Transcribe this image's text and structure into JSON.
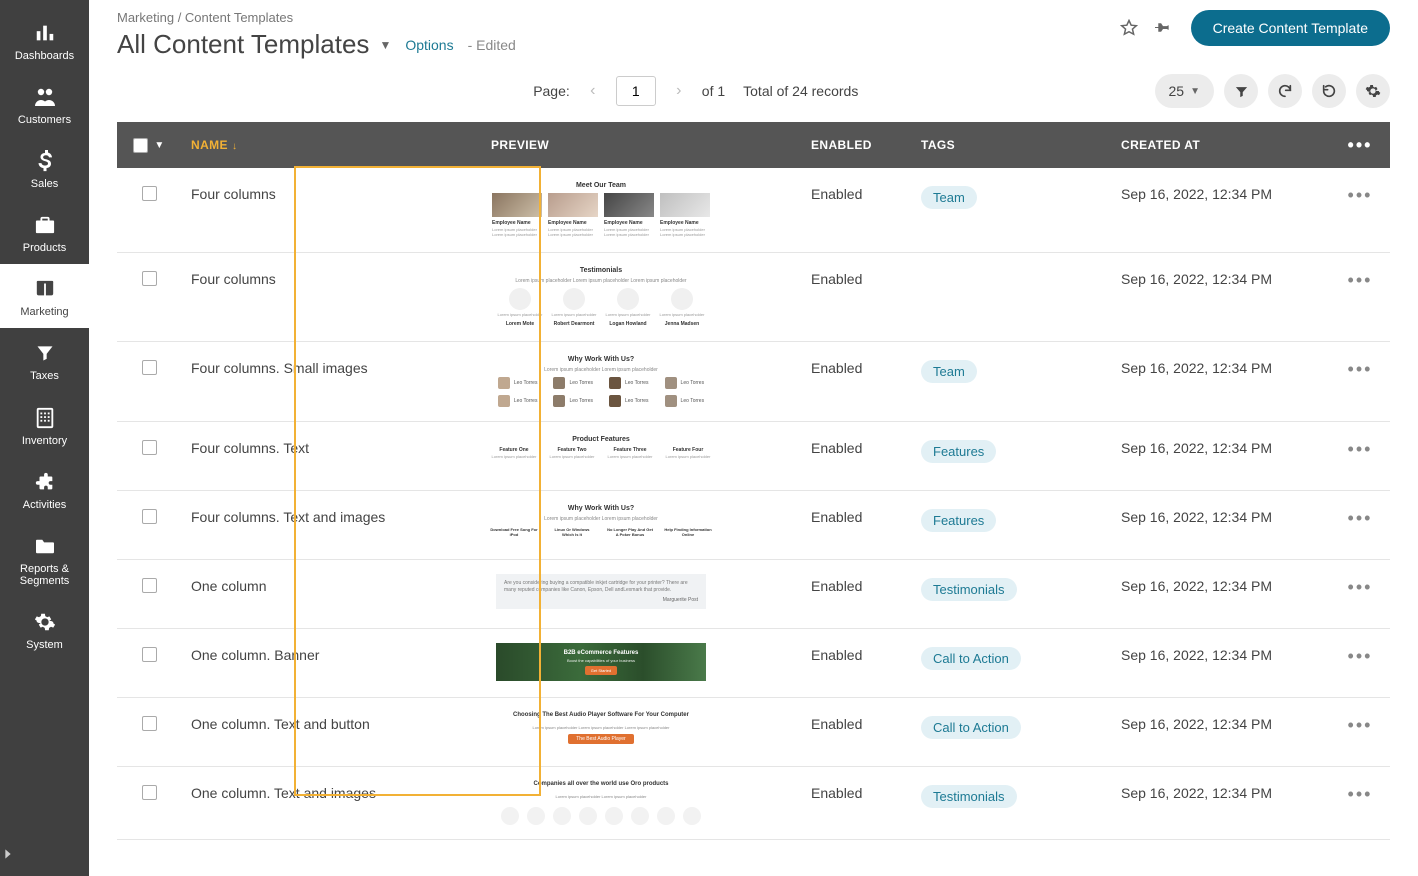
{
  "sidebar": {
    "items": [
      {
        "label": "Dashboards",
        "icon": "dashboards"
      },
      {
        "label": "Customers",
        "icon": "customers"
      },
      {
        "label": "Sales",
        "icon": "sales"
      },
      {
        "label": "Products",
        "icon": "products"
      },
      {
        "label": "Marketing",
        "icon": "marketing"
      },
      {
        "label": "Taxes",
        "icon": "taxes"
      },
      {
        "label": "Inventory",
        "icon": "inventory"
      },
      {
        "label": "Activities",
        "icon": "activities"
      },
      {
        "label": "Reports & Segments",
        "icon": "reports"
      },
      {
        "label": "System",
        "icon": "system"
      }
    ],
    "active_index": 4
  },
  "header": {
    "breadcrumb": "Marketing / Content Templates",
    "title": "All Content Templates",
    "options_label": "Options",
    "edited_label": "- Edited",
    "create_button": "Create Content Template"
  },
  "pager": {
    "label": "Page:",
    "page": "1",
    "of_text": "of 1",
    "total_text": "Total of 24 records",
    "page_size": "25"
  },
  "table": {
    "columns": {
      "name": "NAME",
      "preview": "PREVIEW",
      "enabled": "ENABLED",
      "tags": "TAGS",
      "created_at": "CREATED AT"
    },
    "rows": [
      {
        "name": "Four columns",
        "preview_title": "Meet Our Team",
        "enabled": "Enabled",
        "tag": "Team",
        "created": "Sep 16, 2022, 12:34 PM",
        "preview_type": "team4"
      },
      {
        "name": "Four columns",
        "preview_title": "Testimonials",
        "enabled": "Enabled",
        "tag": "",
        "created": "Sep 16, 2022, 12:34 PM",
        "preview_type": "testimonials4"
      },
      {
        "name": "Four columns. Small images",
        "preview_title": "Why Work With Us?",
        "enabled": "Enabled",
        "tag": "Team",
        "created": "Sep 16, 2022, 12:34 PM",
        "preview_type": "avatars4x2"
      },
      {
        "name": "Four columns. Text",
        "preview_title": "Product Features",
        "enabled": "Enabled",
        "tag": "Features",
        "created": "Sep 16, 2022, 12:34 PM",
        "preview_type": "features4"
      },
      {
        "name": "Four columns. Text and images",
        "preview_title": "Why Work With Us?",
        "enabled": "Enabled",
        "tag": "Features",
        "created": "Sep 16, 2022, 12:34 PM",
        "preview_type": "features4b"
      },
      {
        "name": "One column",
        "preview_title": "",
        "enabled": "Enabled",
        "tag": "Testimonials",
        "created": "Sep 16, 2022, 12:34 PM",
        "preview_type": "quote"
      },
      {
        "name": "One column. Banner",
        "preview_title": "B2B eCommerce Features",
        "enabled": "Enabled",
        "tag": "Call to Action",
        "created": "Sep 16, 2022, 12:34 PM",
        "preview_type": "banner"
      },
      {
        "name": "One column. Text and button",
        "preview_title": "Choosing The Best Audio Player Software For Your Computer",
        "enabled": "Enabled",
        "tag": "Call to Action",
        "created": "Sep 16, 2022, 12:34 PM",
        "preview_type": "textbtn"
      },
      {
        "name": "One column. Text and images",
        "preview_title": "Companies all over the world use Oro products",
        "enabled": "Enabled",
        "tag": "Testimonials",
        "created": "Sep 16, 2022, 12:34 PM",
        "preview_type": "circles"
      }
    ]
  }
}
